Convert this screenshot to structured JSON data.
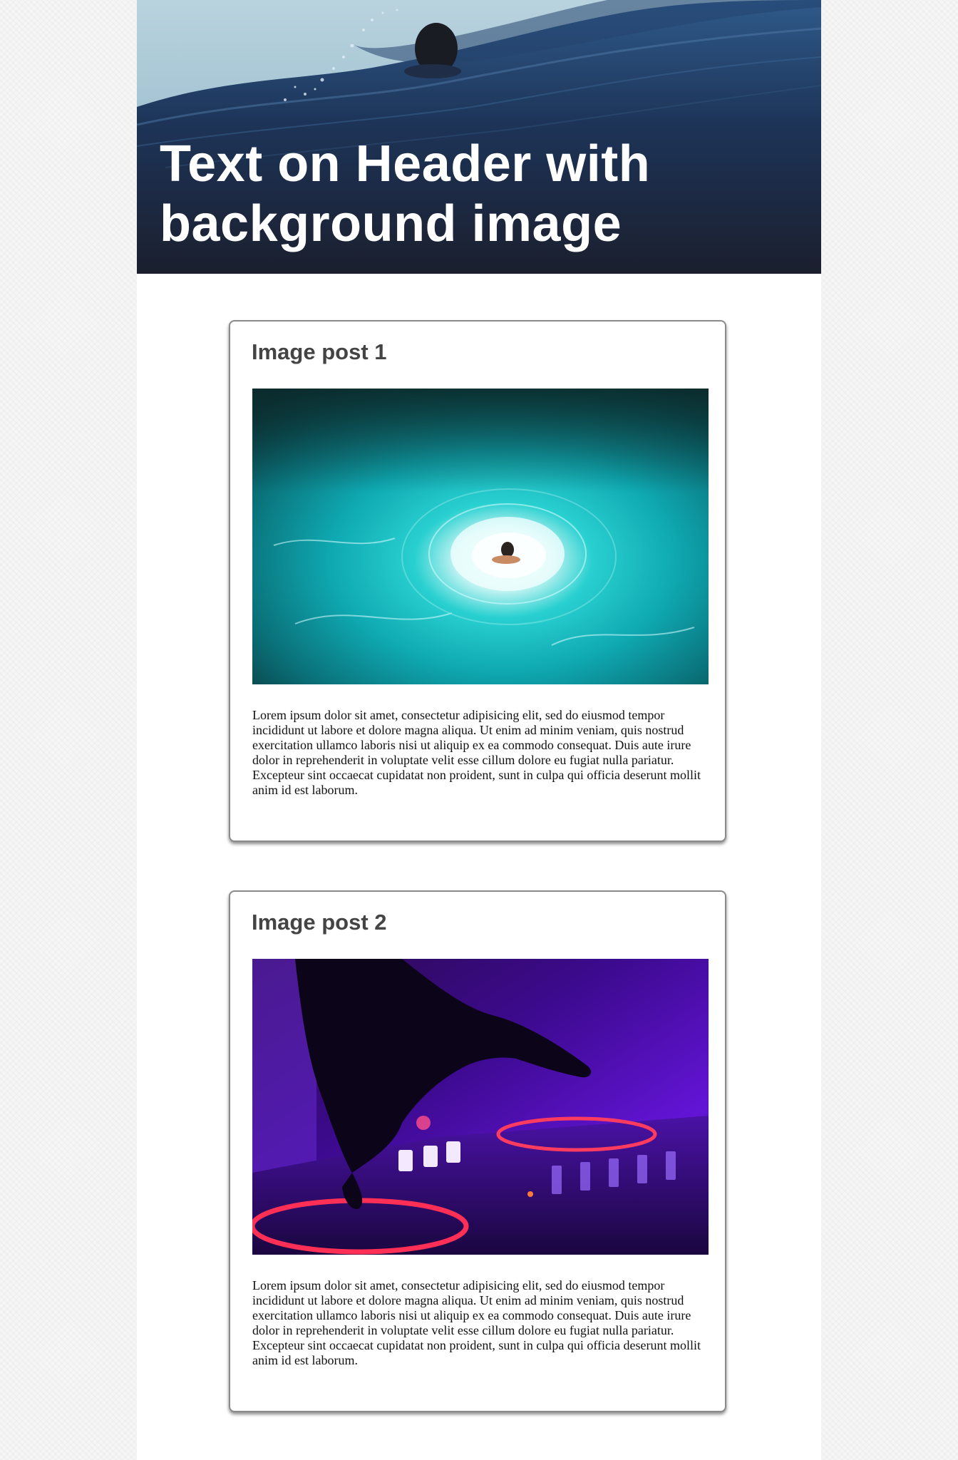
{
  "header": {
    "title": "Text on Header with background image",
    "image_icon": "ocean-swimmer-wave-image"
  },
  "posts": [
    {
      "title": "Image post 1",
      "image_icon": "swimmer-in-turquoise-water-image",
      "body": "Lorem ipsum dolor sit amet, consectetur adipisicing elit, sed do eiusmod tempor incididunt ut labore et dolore magna aliqua. Ut enim ad minim veniam, quis nostrud exercitation ullamco laboris nisi ut aliquip ex ea commodo consequat. Duis aute irure dolor in reprehenderit in voluptate velit esse cillum dolore eu fugiat nulla pariatur. Excepteur sint occaecat cupidatat non proident, sunt in culpa qui officia deserunt mollit anim id est laborum."
    },
    {
      "title": "Image post 2",
      "image_icon": "dj-hand-on-controller-image",
      "body": "Lorem ipsum dolor sit amet, consectetur adipisicing elit, sed do eiusmod tempor incididunt ut labore et dolore magna aliqua. Ut enim ad minim veniam, quis nostrud exercitation ullamco laboris nisi ut aliquip ex ea commodo consequat. Duis aute irure dolor in reprehenderit in voluptate velit esse cillum dolore eu fugiat nulla pariatur. Excepteur sint occaecat cupidatat non proident, sunt in culpa qui officia deserunt mollit anim id est laborum."
    }
  ],
  "colors": {
    "page_background": "#f6f6f6",
    "content_background": "#ffffff",
    "card_border": "#8a8a8a",
    "post_title": "#444444",
    "header_title": "#ffffff",
    "accent_turquoise": "#16b5bd",
    "accent_purple": "#5a12c8",
    "accent_red": "#ff2f56"
  }
}
